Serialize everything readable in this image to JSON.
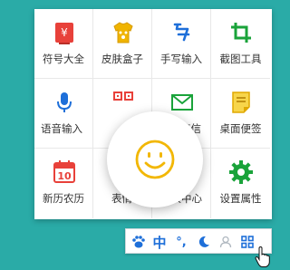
{
  "menu": {
    "items": [
      {
        "label": "符号大全",
        "icon": "symbol-icon"
      },
      {
        "label": "皮肤盒子",
        "icon": "skin-box-icon"
      },
      {
        "label": "手写输入",
        "icon": "handwriting-icon"
      },
      {
        "label": "截图工具",
        "icon": "screenshot-icon"
      },
      {
        "label": "语音输入",
        "icon": "microphone-icon"
      },
      {
        "label": "",
        "icon": "qrcode-icon"
      },
      {
        "label": "亲笔信",
        "icon": "envelope-icon"
      },
      {
        "label": "桌面便签",
        "icon": "sticky-note-icon"
      },
      {
        "label": "新历农历",
        "icon": "calendar-icon"
      },
      {
        "label": "表情中心",
        "icon": "emoji-icon"
      },
      {
        "label": "个人中心",
        "icon": "user-icon"
      },
      {
        "label": "设置属性",
        "icon": "gear-icon"
      }
    ],
    "calendar_day": "10",
    "symbol_glyph": "¥"
  },
  "toolbar": {
    "lang": "中",
    "punct": "°,"
  },
  "colors": {
    "background": "#2aaba7",
    "red": "#e8413a",
    "yellow": "#f0b400",
    "blue": "#1e6fd9",
    "green": "#1aa33a",
    "emoji": "#f2b705"
  }
}
